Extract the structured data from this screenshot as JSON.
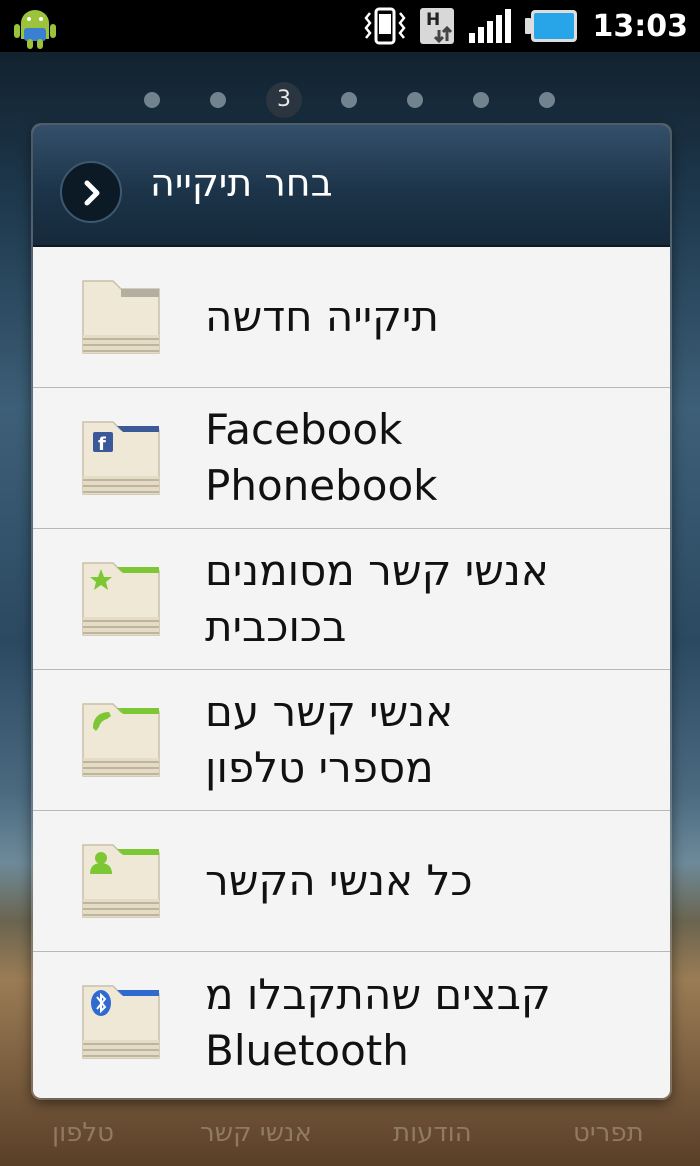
{
  "status_bar": {
    "time": "13:03",
    "network_type": "H",
    "icons": [
      "android-notification-icon",
      "vibrate-icon",
      "data-hspa-icon",
      "signal-icon",
      "battery-icon"
    ]
  },
  "home": {
    "current_page": "3"
  },
  "dialog": {
    "title": "בחר תיקייה",
    "items": [
      {
        "label": "תיקייה חדשה",
        "icon": "folder-icon",
        "accent": "#b4aea0"
      },
      {
        "label": "Facebook Phonebook",
        "icon": "facebook-folder-icon",
        "accent": "#3b5998"
      },
      {
        "label": "אנשי קשר מסומנים בכוכבית",
        "icon": "starred-folder-icon",
        "accent": "#7ec734"
      },
      {
        "label": "אנשי קשר עם מספרי טלפון",
        "icon": "phone-folder-icon",
        "accent": "#7ec734"
      },
      {
        "label": "כל אנשי הקשר",
        "icon": "contact-folder-icon",
        "accent": "#7ec734"
      },
      {
        "label": "קבצים שהתקבלו מ Bluetooth",
        "icon": "bluetooth-folder-icon",
        "accent": "#2f6ad0"
      }
    ]
  },
  "dock": {
    "tabs": [
      "טלפון",
      "אנשי קשר",
      "הודעות",
      "תפריט"
    ]
  },
  "colors": {
    "header": "#1c3449",
    "list_background": "#f4f4f4",
    "dock_text": "#8f7a62"
  }
}
